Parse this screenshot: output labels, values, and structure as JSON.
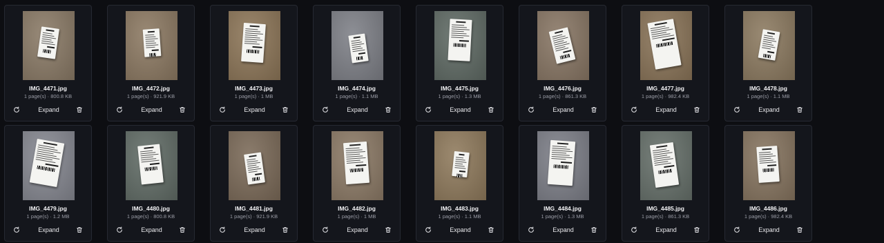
{
  "files": [
    {
      "name": "IMG_4471.jpg",
      "meta": "1 page(s) · 800.8 KB",
      "expand_label": "Expand",
      "bg": "#8a7a66"
    },
    {
      "name": "IMG_4472.jpg",
      "meta": "1 page(s) · 921.9 KB",
      "expand_label": "Expand",
      "bg": "#8c7962"
    },
    {
      "name": "IMG_4473.jpg",
      "meta": "1 page(s) · 1 MB",
      "expand_label": "Expand",
      "bg": "#8d7658"
    },
    {
      "name": "IMG_4474.jpg",
      "meta": "1 page(s) · 1.1 MB",
      "expand_label": "Expand",
      "bg": "#7e8087"
    },
    {
      "name": "IMG_4475.jpg",
      "meta": "1 page(s) · 1.3 MB",
      "expand_label": "Expand",
      "bg": "#5f6a64"
    },
    {
      "name": "IMG_4476.jpg",
      "meta": "1 page(s) · 861.3 KB",
      "expand_label": "Expand",
      "bg": "#887664"
    },
    {
      "name": "IMG_4477.jpg",
      "meta": "1 page(s) · 982.4 KB",
      "expand_label": "Expand",
      "bg": "#8a7458"
    },
    {
      "name": "IMG_4478.jpg",
      "meta": "1 page(s) · 1.1 MB",
      "expand_label": "Expand",
      "bg": "#8c7a60"
    },
    {
      "name": "IMG_4479.jpg",
      "meta": "1 page(s) · 1.2 MB",
      "expand_label": "Expand",
      "bg": "#868891"
    },
    {
      "name": "IMG_4480.jpg",
      "meta": "1 page(s) · 800.8 KB",
      "expand_label": "Expand",
      "bg": "#616c66"
    },
    {
      "name": "IMG_4481.jpg",
      "meta": "1 page(s) · 921.9 KB",
      "expand_label": "Expand",
      "bg": "#7b6a58"
    },
    {
      "name": "IMG_4482.jpg",
      "meta": "1 page(s) · 1 MB",
      "expand_label": "Expand",
      "bg": "#8c7a66"
    },
    {
      "name": "IMG_4483.jpg",
      "meta": "1 page(s) · 1.1 MB",
      "expand_label": "Expand",
      "bg": "#8f7a5c"
    },
    {
      "name": "IMG_4484.jpg",
      "meta": "1 page(s) · 1.3 MB",
      "expand_label": "Expand",
      "bg": "#7d7f88"
    },
    {
      "name": "IMG_4485.jpg",
      "meta": "1 page(s) · 861.3 KB",
      "expand_label": "Expand",
      "bg": "#66706a"
    },
    {
      "name": "IMG_4486.jpg",
      "meta": "1 page(s) · 982.4 KB",
      "expand_label": "Expand",
      "bg": "#86745f"
    }
  ],
  "icons": {
    "rotate": "rotate-icon",
    "delete": "trash-icon"
  },
  "colors": {
    "background": "#0d0e12",
    "card": "#14161c",
    "card_border": "#262932",
    "text": "#f2f2f4",
    "muted": "#9a9ca6"
  }
}
